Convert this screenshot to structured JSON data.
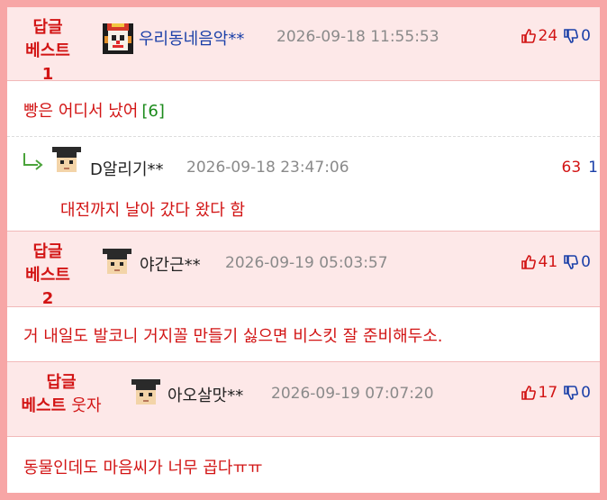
{
  "comments": [
    {
      "best_label": "답글",
      "best_rank": "베스트1",
      "nickname": "우리동네음악**",
      "time": "2026-09-18 11:55:53",
      "likes": "24",
      "dislikes": "0",
      "text": "빵은 어디서 났어",
      "reply_count": "[6]",
      "avatar": "clown-avatar-icon"
    },
    {
      "is_reply": true,
      "nickname": "D알리기**",
      "time": "2026-09-18 23:47:06",
      "likes": "63",
      "dislikes": "1",
      "text": "대전까지 날아 갔다 왔다 함",
      "avatar": "student-avatar-icon"
    },
    {
      "best_label": "답글",
      "best_rank": "베스트2",
      "nickname": "야간근**",
      "time": "2026-09-19 05:03:57",
      "likes": "41",
      "dislikes": "0",
      "text": "거 내일도 발코니 거지꼴 만들기 싫으면 비스킷 잘 준비해두소.",
      "avatar": "student-avatar-icon"
    },
    {
      "best_label": "답글",
      "best_rank": "베스트",
      "best_suffix": "웃자",
      "nickname": "아오살맛**",
      "time": "2026-09-19 07:07:20",
      "likes": "17",
      "dislikes": "0",
      "text": "동물인데도 마음씨가 너무 곱다ㅠㅠ",
      "avatar": "student-avatar-icon"
    }
  ],
  "colors": {
    "frame": "#f7a6a6",
    "header_bg": "#fde8e8",
    "accent_red": "#d21414",
    "nick_blue": "#1a3fa8",
    "count_green": "#1a8a1a"
  }
}
